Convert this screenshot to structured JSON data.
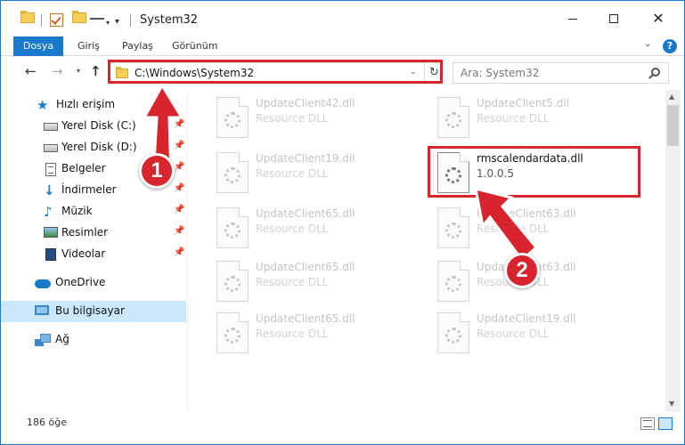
{
  "window": {
    "title": "System32",
    "min_glyph": "",
    "close_glyph": "✕"
  },
  "ribbon": {
    "tabs": [
      "Dosya",
      "Giriş",
      "Paylaş",
      "Görünüm"
    ],
    "help": "?"
  },
  "nav": {
    "path": "C:\\Windows\\System32",
    "search_placeholder": "Ara: System32",
    "refresh_glyph": "↻"
  },
  "sidebar": {
    "items": [
      {
        "label": "Hızlı erişim",
        "icon": "quick-access-star-icon",
        "pinned": false
      },
      {
        "label": "Yerel Disk (C:)",
        "icon": "drive-icon",
        "pinned": true
      },
      {
        "label": "Yerel Disk (D:)",
        "icon": "drive-icon",
        "pinned": true
      },
      {
        "label": "Belgeler",
        "icon": "documents-icon",
        "pinned": true
      },
      {
        "label": "İndirmeler",
        "icon": "downloads-icon",
        "pinned": true
      },
      {
        "label": "Müzik",
        "icon": "music-icon",
        "pinned": true
      },
      {
        "label": "Resimler",
        "icon": "pictures-icon",
        "pinned": true
      },
      {
        "label": "Videolar",
        "icon": "videos-icon",
        "pinned": true
      },
      {
        "label": "OneDrive",
        "icon": "onedrive-icon",
        "pinned": false
      },
      {
        "label": "Bu bilgisayar",
        "icon": "this-pc-icon",
        "pinned": false,
        "selected": true
      },
      {
        "label": "Ağ",
        "icon": "network-icon",
        "pinned": false
      }
    ]
  },
  "files": [
    {
      "name": "UpdateClient42.dll",
      "type": "Resource DLL"
    },
    {
      "name": "UpdateClient5.dll",
      "type": "Resource DLL"
    },
    {
      "name": "UpdateClient19.dll",
      "type": "Resource DLL"
    },
    {
      "name": "rmscalendardata.dll",
      "type": "1.0.0.5",
      "active": true
    },
    {
      "name": "UpdateClient65.dll",
      "type": "Resource DLL"
    },
    {
      "name": "UpdateClient63.dll",
      "type": "Resource DLL"
    },
    {
      "name": "UpdateClient65.dll",
      "type": "Resource DLL"
    },
    {
      "name": "UpdateClient63.dll",
      "type": "Resource DLL"
    },
    {
      "name": "UpdateClient65.dll",
      "type": "Resource DLL"
    },
    {
      "name": "UpdateClient19.dll",
      "type": "Resource DLL"
    }
  ],
  "status": {
    "item_count": "186 öğe"
  },
  "annotations": {
    "step1": "1",
    "step2": "2",
    "color": "#d8242c"
  }
}
